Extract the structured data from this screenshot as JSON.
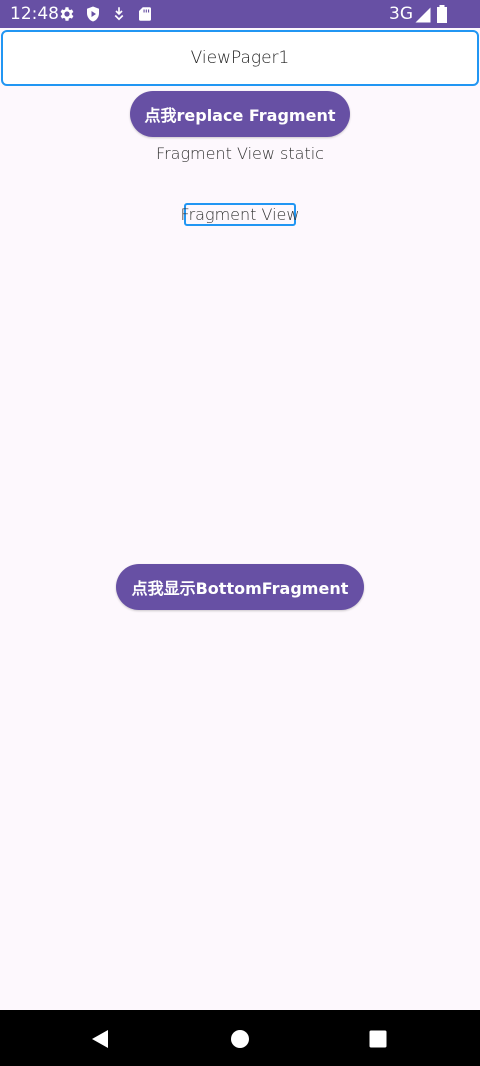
{
  "status_bar": {
    "time": "12:48",
    "network": "3G",
    "icons": [
      "settings-icon",
      "shield-icon",
      "download-icon",
      "sd-card-icon",
      "signal-icon",
      "battery-icon"
    ],
    "background": "#6750a4"
  },
  "title_field": {
    "text": "ViewPager1",
    "border_color": "#2196f3"
  },
  "buttons": {
    "replace_label": "点我replace Fragment",
    "bottom_label": "点我显示BottomFragment",
    "color": "#6750a4"
  },
  "content": {
    "static_text": "Fragment View static",
    "fragment_view_text": "Fragment View"
  },
  "nav_bar": {
    "icons": [
      "back-icon",
      "home-icon",
      "recents-icon"
    ]
  }
}
